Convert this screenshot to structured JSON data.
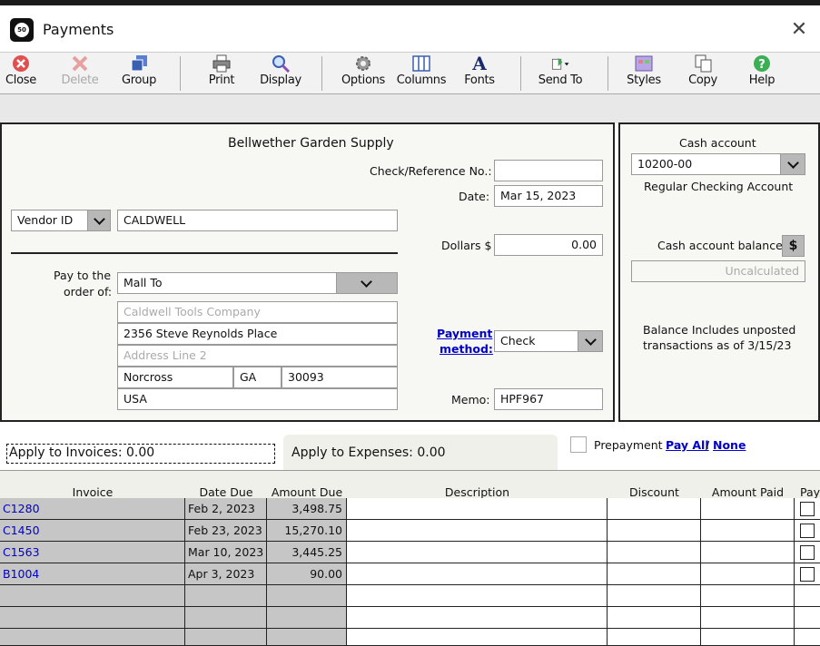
{
  "window": {
    "title": "Payments",
    "logo_text": "50"
  },
  "toolbar": {
    "close": "Close",
    "delete": "Delete",
    "group": "Group",
    "print": "Print",
    "display": "Display",
    "options": "Options",
    "columns": "Columns",
    "fonts": "Fonts",
    "send_to": "Send To",
    "styles": "Styles",
    "copy": "Copy",
    "help": "Help",
    "fonts_glyph": "A"
  },
  "form": {
    "company": "Bellwether Garden Supply",
    "check_ref_label": "Check/Reference No.:",
    "check_ref_value": "",
    "date_label": "Date:",
    "date_value": "Mar 15, 2023",
    "vendor_id_label": "Vendor ID",
    "vendor_id_value": "CALDWELL",
    "dollars_label": "Dollars $",
    "dollars_value": "0.00",
    "pay_to_label_1": "Pay to the",
    "pay_to_label_2": "order of:",
    "pay_to_select": "Mall To",
    "name_placeholder": "Caldwell Tools Company",
    "address1": "2356 Steve Reynolds Place",
    "address2_placeholder": "Address Line 2",
    "city": "Norcross",
    "state": "GA",
    "zip": "30093",
    "country": "USA",
    "payment_method_label_1": "Payment",
    "payment_method_label_2": "method:",
    "payment_method_value": "Check",
    "memo_label": "Memo:",
    "memo_value": "HPF967"
  },
  "cash": {
    "title": "Cash account",
    "account": "10200-00",
    "account_name": "Regular Checking Account",
    "balance_label": "Cash account balance",
    "balance_button": "$",
    "balance_value": "Uncalculated",
    "note_line1": "Balance Includes unposted",
    "note_line2": "transactions as of 3/15/23"
  },
  "tabs": {
    "invoices": "Apply to Invoices: 0.00",
    "expenses": "Apply to Expenses: 0.00",
    "prepayment": "Prepayment",
    "pay_all": "Pay All",
    "slash": "/",
    "none": "None"
  },
  "grid": {
    "headers": [
      "Invoice",
      "Date Due",
      "Amount Due",
      "Description",
      "Discount",
      "Amount Paid",
      "Pay"
    ],
    "rows": [
      {
        "invoice": "C1280",
        "date_due": "Feb 2, 2023",
        "amount_due": "3,498.75"
      },
      {
        "invoice": "C1450",
        "date_due": "Feb 23, 2023",
        "amount_due": "15,270.10"
      },
      {
        "invoice": "C1563",
        "date_due": "Mar 10, 2023",
        "amount_due": "3,445.25"
      },
      {
        "invoice": "B1004",
        "date_due": "Apr 3, 2023",
        "amount_due": "90.00"
      }
    ]
  },
  "colors": {
    "link": "#0000cc",
    "panel_bg": "#f7f7f3",
    "grid_gray": "#c6c6c6",
    "close_red": "#e05050",
    "help_green": "#3cae55"
  }
}
